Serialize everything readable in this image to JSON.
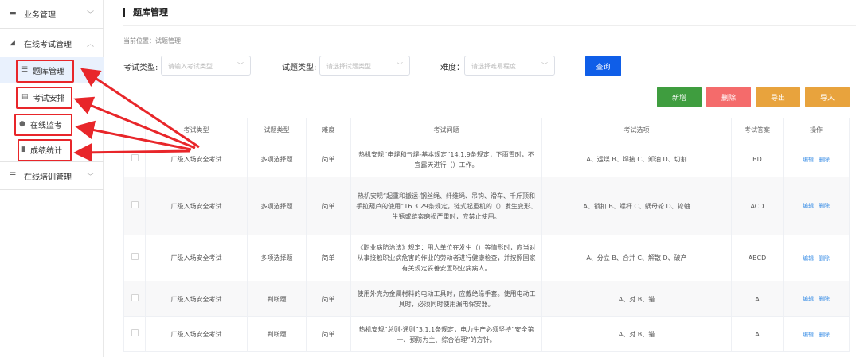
{
  "sidebar": {
    "groups": [
      {
        "label": "业务管理",
        "icon": "briefcase-icon"
      },
      {
        "label": "在线考试管理",
        "icon": "graduation-cap-icon"
      },
      {
        "label": "在线培训管理",
        "icon": "list-icon"
      }
    ],
    "items": [
      {
        "label": "题库管理",
        "icon": "list-icon"
      },
      {
        "label": "考试安排",
        "icon": "id-card-icon"
      },
      {
        "label": "在线监考",
        "icon": "user-icon"
      },
      {
        "label": "成绩统计",
        "icon": "document-icon"
      }
    ]
  },
  "header": {
    "title": "题库管理",
    "breadcrumb": "当前位置：试题管理"
  },
  "filters": {
    "exam_type": {
      "label": "考试类型:",
      "placeholder": "请输入考试类型"
    },
    "question_type": {
      "label": "试题类型:",
      "placeholder": "请选择试题类型"
    },
    "difficulty": {
      "label": "难度：",
      "placeholder": "请选择难易程度"
    },
    "query_label": "查询"
  },
  "toolbar": {
    "add": "新增",
    "delete": "删除",
    "export": "导出",
    "import": "导入"
  },
  "colors": {
    "primary": "#0f5ee8",
    "add": "#3f9d3f",
    "delete": "#f46b6b",
    "export": "#e8a33d",
    "annotation": "#e8262a"
  },
  "table": {
    "columns": [
      "考试类型",
      "试题类型",
      "难度",
      "考试问题",
      "考试选项",
      "考试答案",
      "操作"
    ],
    "actions": {
      "edit": "编辑",
      "delete": "删除"
    },
    "rows": [
      {
        "exam_type": "厂级入场安全考试",
        "question_type": "多项选择题",
        "difficulty": "简单",
        "question": "热机安规“电焊和气焊-基本规定”14.1.9条规定，下雨雪时，不宜露天进行（）工作。",
        "options": "A、运煤 B、焊接 C、卸油 D、切割",
        "answer": "BD"
      },
      {
        "exam_type": "厂级入场安全考试",
        "question_type": "多项选择题",
        "difficulty": "简单",
        "question": "热机安规“起重和搬运-钢丝绳、纤维绳、吊钩、滑车、千斤顶和手拉葫芦的使用”16.3.29条规定，链式起重机的（）发生变形、生锈或链索磨损严重时，应禁止使用。",
        "options": "A、锁扣 B、螺杆 C、蜗母轮 D、轮轴",
        "answer": "ACD"
      },
      {
        "exam_type": "厂级入场安全考试",
        "question_type": "多项选择题",
        "difficulty": "简单",
        "question": "《职业病防治法》规定：用人单位在发生（）等情形时，应当对从事接触职业病危害的作业的劳动者进行健康检查，并按照国家有关规定妥善安置职业病病人。",
        "options": "A、分立 B、合并 C、解散 D、破产",
        "answer": "ABCD"
      },
      {
        "exam_type": "厂级入场安全考试",
        "question_type": "判断题",
        "difficulty": "简单",
        "question": "使用外壳为金属材料的电动工具时，应戴绝缘手套。使用电动工具时，必须同时使用漏电保安器。",
        "options": "A、对 B、错",
        "answer": "A"
      },
      {
        "exam_type": "厂级入场安全考试",
        "question_type": "判断题",
        "difficulty": "简单",
        "question": "热机安规“总则-通则”3.1.1条规定，电力生产必须坚持“安全第一、预防为主、综合治理”的方针。",
        "options": "A、对 B、错",
        "answer": "A"
      }
    ]
  }
}
